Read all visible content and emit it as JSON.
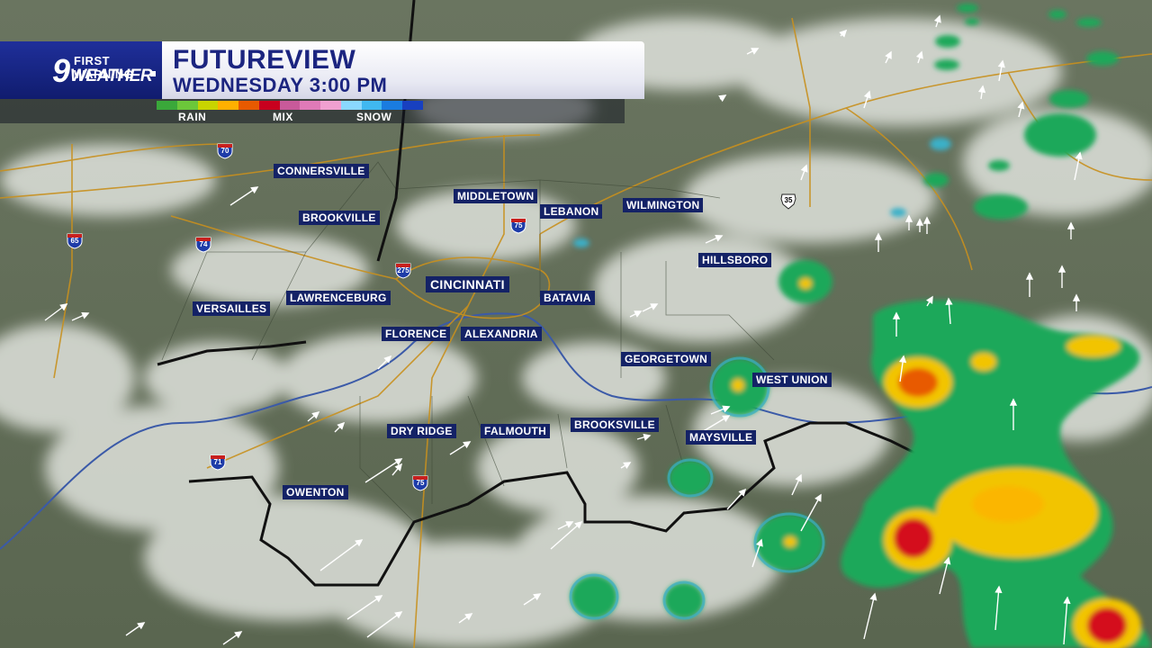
{
  "brand": {
    "number": "9",
    "line1": "FIRST WARNING",
    "line2": "WEATHER"
  },
  "title": "FUTUREVIEW",
  "subtitle": "WEDNESDAY 3:00 PM",
  "legend": {
    "rain_label": "RAIN",
    "mix_label": "MIX",
    "snow_label": "SNOW",
    "rain_colors": [
      "#3aa83a",
      "#6cc73a",
      "#c8d400",
      "#ffb000",
      "#e85a00",
      "#c8001e"
    ],
    "mix_colors": [
      "#c85a9a",
      "#e07ab8",
      "#f0a0d0"
    ],
    "snow_colors": [
      "#8ad8ff",
      "#40b8f0",
      "#1a7ce0",
      "#1840c0"
    ]
  },
  "cities": [
    {
      "name": "CONNERSVILLE"
    },
    {
      "name": "BROOKVILLE"
    },
    {
      "name": "MIDDLETOWN"
    },
    {
      "name": "LEBANON"
    },
    {
      "name": "WILMINGTON"
    },
    {
      "name": "HILLSBORO"
    },
    {
      "name": "CINCINNATI"
    },
    {
      "name": "LAWRENCEBURG"
    },
    {
      "name": "VERSAILLES"
    },
    {
      "name": "BATAVIA"
    },
    {
      "name": "FLORENCE"
    },
    {
      "name": "ALEXANDRIA"
    },
    {
      "name": "GEORGETOWN"
    },
    {
      "name": "WEST UNION"
    },
    {
      "name": "DRY RIDGE"
    },
    {
      "name": "FALMOUTH"
    },
    {
      "name": "BROOKSVILLE"
    },
    {
      "name": "MAYSVILLE"
    },
    {
      "name": "OWENTON"
    }
  ],
  "highways": [
    {
      "number": "70",
      "type": "interstate"
    },
    {
      "number": "65",
      "type": "interstate"
    },
    {
      "number": "74",
      "type": "interstate"
    },
    {
      "number": "275",
      "type": "interstate"
    },
    {
      "number": "75",
      "type": "interstate"
    },
    {
      "number": "71",
      "type": "interstate"
    },
    {
      "number": "75",
      "type": "interstate"
    },
    {
      "number": "35",
      "type": "us"
    }
  ],
  "colors": {
    "land": "#5f6b55",
    "cloud": "#d8dcd6",
    "border": "#111111",
    "river": "#3b5aa8",
    "road": "#c8901e",
    "label_bg": "#142266"
  }
}
